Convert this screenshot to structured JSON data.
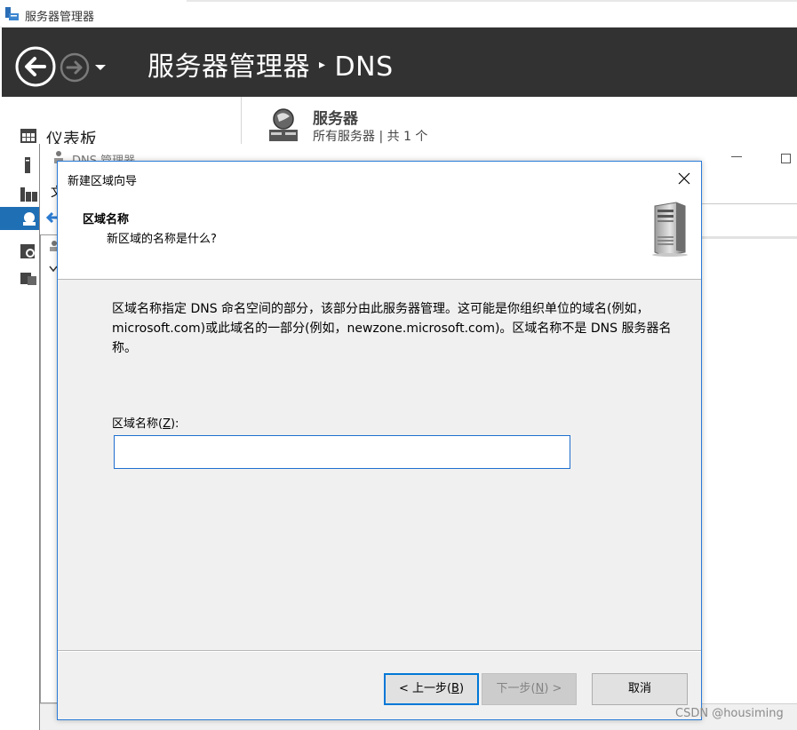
{
  "server_manager": {
    "window_title": "服务器管理器",
    "breadcrumb_root": "服务器管理器",
    "breadcrumb_separator": "▸",
    "breadcrumb_current": "DNS",
    "sidebar": {
      "dashboard_label": "仪表板"
    },
    "servers_panel": {
      "heading": "服务器",
      "subheading": "所有服务器 | 共 1 个"
    }
  },
  "dns_manager": {
    "window_title": "DNS 管理器",
    "menu_first_letter": "文"
  },
  "wizard": {
    "title": "新建区域向导",
    "page_heading": "区域名称",
    "page_subheading": "新区域的名称是什么?",
    "description": "区域名称指定 DNS 命名空间的部分，该部分由此服务器管理。这可能是你组织单位的域名(例如，microsoft.com)或此域名的一部分(例如，newzone.microsoft.com)。区域名称不是 DNS 服务器名称。",
    "zone_name_label": "区域名称(",
    "zone_name_hotkey": "Z",
    "zone_name_label_end": "):",
    "zone_name_value": "",
    "buttons": {
      "back_prefix": "< 上一步(",
      "back_key": "B",
      "back_suffix": ")",
      "next_prefix": "下一步(",
      "next_key": "N",
      "next_suffix": ") >",
      "cancel": "取消"
    },
    "close_glyph": "✕"
  },
  "watermark": "CSDN @housiming",
  "colors": {
    "header_bg": "#323232",
    "accent_blue": "#0078d7",
    "sidebar_active": "#1f6fb5",
    "dialog_bg": "#f0f0f0"
  },
  "icons": [
    "server-manager-app-icon",
    "back-arrow-icon",
    "forward-arrow-icon",
    "dropdown-icon",
    "dashboard-icon",
    "local-server-icon",
    "all-servers-icon",
    "dns-role-icon",
    "file-services-icon",
    "iis-icon",
    "servers-globe-icon",
    "server-tower-icon",
    "close-icon"
  ]
}
